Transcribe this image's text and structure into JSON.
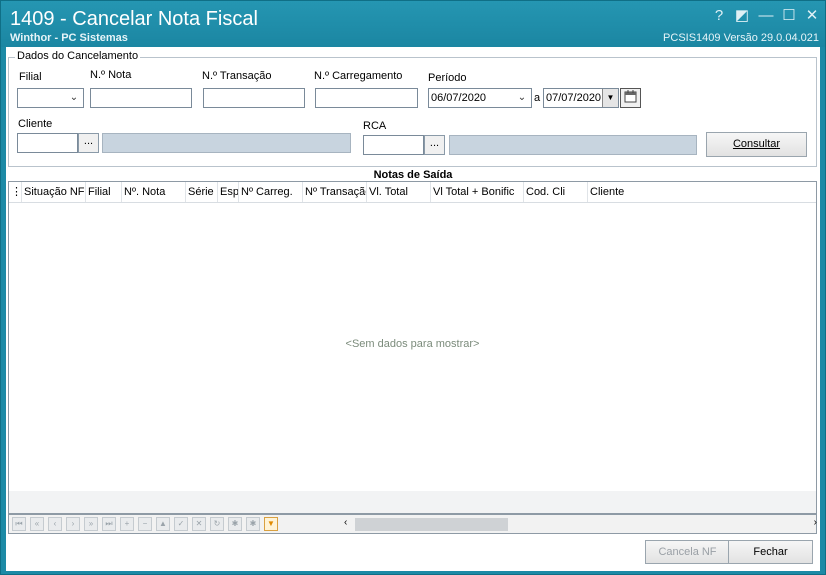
{
  "window": {
    "title": "1409 - Cancelar Nota Fiscal",
    "subtitle": "Winthor - PC Sistemas",
    "version": "PCSIS1409  Versão  29.0.04.021",
    "controls": {
      "help": "?",
      "restore": "◩",
      "minimize": "—",
      "maximize": "☐",
      "close": "✕"
    }
  },
  "form": {
    "group_title": "Dados do Cancelamento",
    "filial_label": "Filial",
    "nota_label": "N.º Nota",
    "transacao_label": "N.º Transação",
    "carregamento_label": "N.º Carregamento",
    "periodo_label": "Período",
    "date_from": "06/07/2020",
    "date_sep": "a",
    "date_to": "07/07/2020",
    "cliente_label": "Cliente",
    "rca_label": "RCA",
    "ellipsis": "...",
    "consultar_label": "Consultar"
  },
  "grid": {
    "title": "Notas de Saída",
    "columns": [
      "Situação NFe",
      "Filial",
      "Nº. Nota",
      "Série",
      "Esp",
      "Nº Carreg.",
      "Nº Transação",
      "Vl. Total",
      "Vl Total + Bonific",
      "Cod. Cli",
      "Cliente"
    ],
    "empty_text": "<Sem dados para mostrar>"
  },
  "navigator": {
    "buttons": [
      "⏮",
      "«",
      "‹",
      "›",
      "»",
      "⏭",
      "+",
      "−",
      "▲",
      "✓",
      "✕",
      "↻",
      "✱",
      "✱",
      "▼"
    ]
  },
  "actions": {
    "cancel_nf_label": "Cancela NF",
    "close_label": "Fechar"
  }
}
